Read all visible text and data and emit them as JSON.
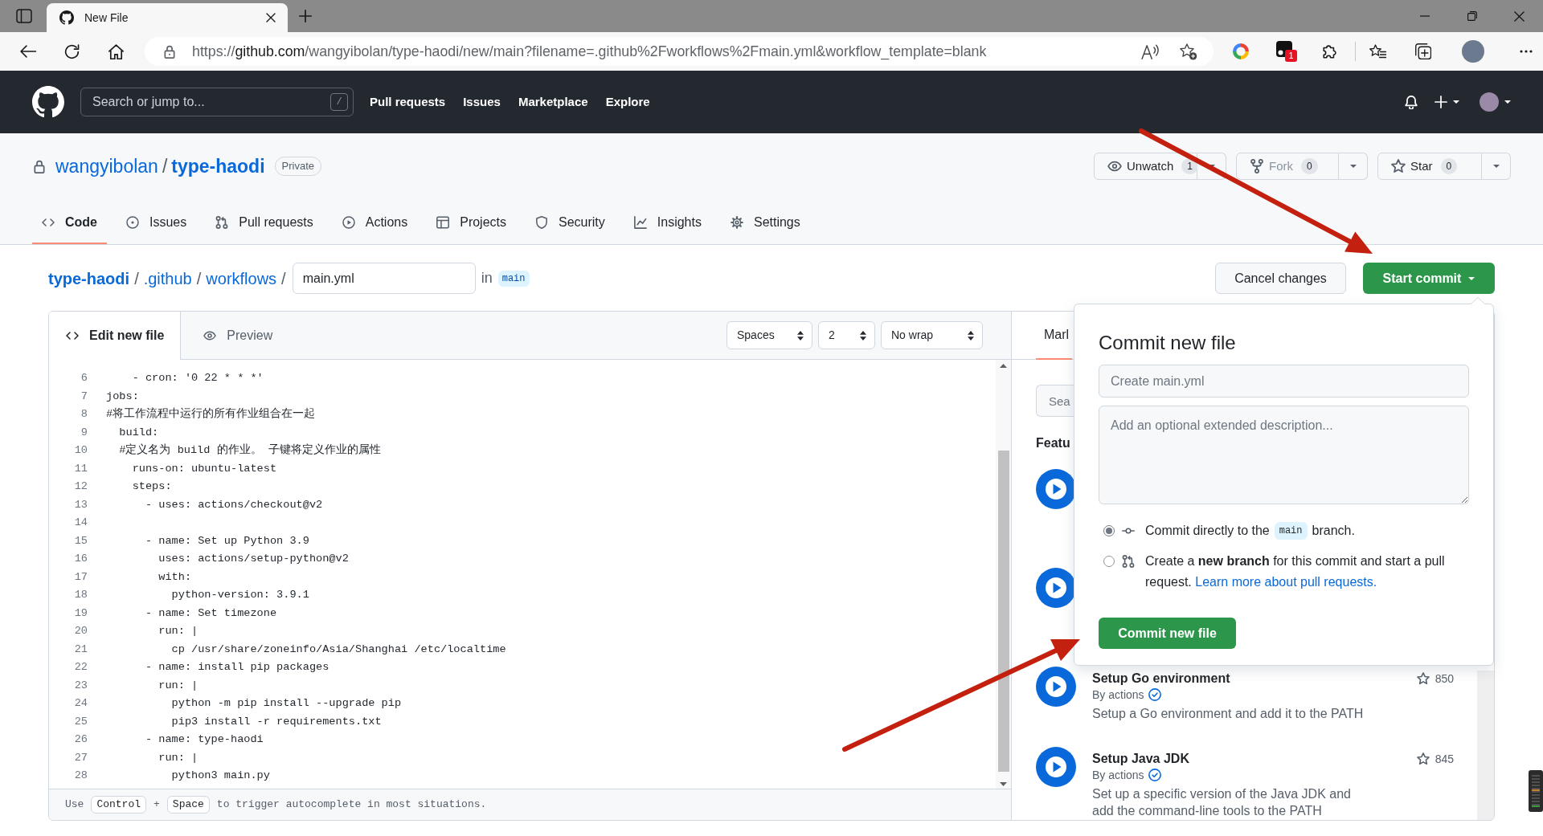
{
  "browser": {
    "tab_title": "New File",
    "url": {
      "scheme": "https://",
      "host": "github.com",
      "path": "/wangyibolan/type-haodi/new/main?filename=.github%2Fworkflows%2Fmain.yml&workflow_template=blank"
    },
    "extension_badge": "1"
  },
  "header": {
    "search": {
      "placeholder": "Search or jump to...",
      "shortcut": "/"
    },
    "nav": [
      "Pull requests",
      "Issues",
      "Marketplace",
      "Explore"
    ]
  },
  "repo": {
    "owner": "wangyibolan",
    "separator": "/",
    "name": "type-haodi",
    "visibility": "Private",
    "buttons": [
      {
        "kind": "watch",
        "label": "Unwatch",
        "count": "1",
        "disabled": false
      },
      {
        "kind": "fork",
        "label": "Fork",
        "count": "0",
        "disabled": true
      },
      {
        "kind": "star",
        "label": "Star",
        "count": "0",
        "disabled": false
      }
    ],
    "tabs": [
      {
        "kind": "code",
        "label": "Code",
        "selected": true
      },
      {
        "kind": "issues",
        "label": "Issues",
        "selected": false
      },
      {
        "kind": "pulls",
        "label": "Pull requests",
        "selected": false
      },
      {
        "kind": "actions",
        "label": "Actions",
        "selected": false
      },
      {
        "kind": "projects",
        "label": "Projects",
        "selected": false
      },
      {
        "kind": "security",
        "label": "Security",
        "selected": false
      },
      {
        "kind": "insights",
        "label": "Insights",
        "selected": false
      },
      {
        "kind": "settings",
        "label": "Settings",
        "selected": false
      }
    ]
  },
  "breadcrumb": {
    "segments": [
      {
        "kind": "repo",
        "label": "type-haodi",
        "separator": "/"
      },
      {
        "kind": "dir",
        "label": ".github",
        "separator": "/"
      },
      {
        "kind": "dir",
        "label": "workflows",
        "separator": "/"
      }
    ],
    "filename": "main.yml",
    "branch_prefix": "in",
    "branch": "main"
  },
  "commit_actions": {
    "cancel": "Cancel changes",
    "start": "Start commit"
  },
  "editor": {
    "tabs": [
      {
        "kind": "edit",
        "label": "Edit new file",
        "selected": true
      },
      {
        "kind": "preview",
        "label": "Preview",
        "selected": false
      }
    ],
    "selects": [
      "Spaces",
      "2",
      "No wrap"
    ],
    "lines": [
      {
        "number": "6",
        "code": "    - cron: '0 22 * * *'"
      },
      {
        "number": "7",
        "code": "jobs:"
      },
      {
        "number": "8",
        "code": "#将工作流程中运行的所有作业组合在一起"
      },
      {
        "number": "9",
        "code": "  build:"
      },
      {
        "number": "10",
        "code": "  #定义名为 build 的作业。 子键将定义作业的属性"
      },
      {
        "number": "11",
        "code": "    runs-on: ubuntu-latest"
      },
      {
        "number": "12",
        "code": "    steps:"
      },
      {
        "number": "13",
        "code": "      - uses: actions/checkout@v2"
      },
      {
        "number": "14"
      },
      {
        "number": "15",
        "code": "      - name: Set up Python 3.9"
      },
      {
        "number": "16",
        "code": "        uses: actions/setup-python@v2"
      },
      {
        "number": "17",
        "code": "        with:"
      },
      {
        "number": "18",
        "code": "          python-version: 3.9.1"
      },
      {
        "number": "19",
        "code": "      - name: Set timezone"
      },
      {
        "number": "20",
        "code": "        run: |"
      },
      {
        "number": "21",
        "code": "          cp /usr/share/zoneinfo/Asia/Shanghai /etc/localtime"
      },
      {
        "number": "22",
        "code": "      - name: install pip packages"
      },
      {
        "number": "23",
        "code": "        run: |"
      },
      {
        "number": "24",
        "code": "          python -m pip install --upgrade pip"
      },
      {
        "number": "25",
        "code": "          pip3 install -r requirements.txt"
      },
      {
        "number": "26",
        "code": "      - name: type-haodi"
      },
      {
        "number": "27",
        "code": "        run: |"
      },
      {
        "number": "28",
        "code": "          python3 main.py"
      }
    ],
    "hint": {
      "parts": [
        {
          "kind": "text",
          "text": "Use"
        },
        {
          "kind": "key",
          "text": "Control"
        },
        {
          "kind": "text",
          "text": "+"
        },
        {
          "kind": "key",
          "text": "Space"
        },
        {
          "kind": "text",
          "text": "to trigger autocomplete in most situations."
        }
      ]
    }
  },
  "marketplace": {
    "tabs": [
      {
        "label": "Marl",
        "selected": true
      }
    ],
    "search_placeholder": "Sea",
    "heading": "Featu",
    "items": [
      {
        "kind": "covered"
      },
      {
        "kind": "covered"
      },
      {
        "kind": "card",
        "title": "Setup Go environment",
        "author": "By actions",
        "description": "Setup a Go environment and add it to the PATH",
        "star_count": "850"
      },
      {
        "kind": "card",
        "title": "Setup Java JDK",
        "author": "By actions",
        "description": "Set up a specific version of the Java JDK and add the command-line tools to the PATH",
        "star_count": "845"
      }
    ]
  },
  "commit_dialog": {
    "title": "Commit new file",
    "summary_placeholder": "Create main.yml",
    "description_placeholder": "Add an optional extended description...",
    "options": [
      {
        "kind": "direct",
        "selected": true,
        "before": "Commit directly to the",
        "branch": "main",
        "after": "branch."
      },
      {
        "kind": "branch",
        "selected": false,
        "text": "Create a **new branch** for this commit and start a pull request.",
        "link": "Learn more about pull requests."
      }
    ],
    "submit": "Commit new file"
  }
}
